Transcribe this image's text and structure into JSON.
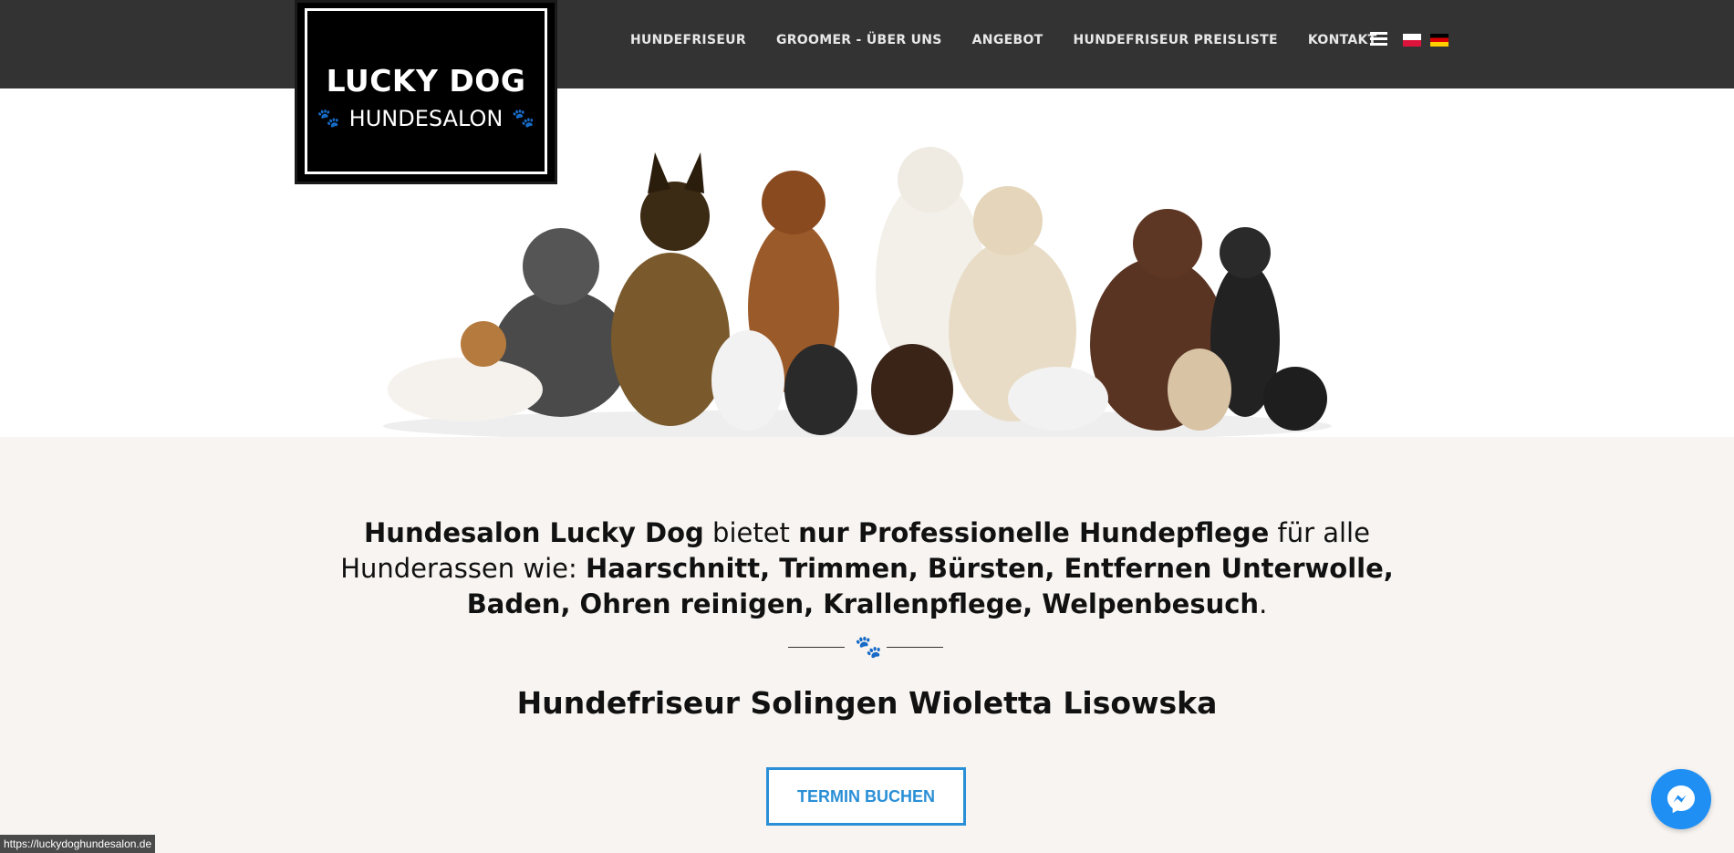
{
  "header": {
    "logo_title": "LUCKY DOG",
    "logo_subtitle": "HUNDESALON",
    "nav": [
      {
        "label": "HUNDEFRISEUR"
      },
      {
        "label": "GROOMER - ÜBER UNS"
      },
      {
        "label": "ANGEBOT"
      },
      {
        "label": "HUNDEFRISEUR PREISLISTE"
      },
      {
        "label": "KONTAKT"
      }
    ]
  },
  "main": {
    "intro_parts": [
      {
        "text": "Hundesalon Lucky Dog",
        "bold": true
      },
      {
        "text": " bietet ",
        "bold": false
      },
      {
        "text": "nur Professionelle Hundepflege",
        "bold": true
      },
      {
        "text": " für alle Hunderassen wie: ",
        "bold": false
      },
      {
        "text": "Haarschnitt, Trimmen, Bürsten, Entfernen Unterwolle, Baden, Ohren reinigen, Krallenpflege, Welpenbesuch",
        "bold": true
      },
      {
        "text": ".",
        "bold": false
      }
    ],
    "subtitle": "Hundefriseur Solingen Wioletta Lisowska",
    "cta_label": "TERMIN BUCHEN"
  },
  "status_bar": {
    "url": "https://luckydoghundesalon.de"
  },
  "colors": {
    "topbar": "#333333",
    "accent": "#2a8fd6",
    "content_bg": "#f7f4f1"
  }
}
